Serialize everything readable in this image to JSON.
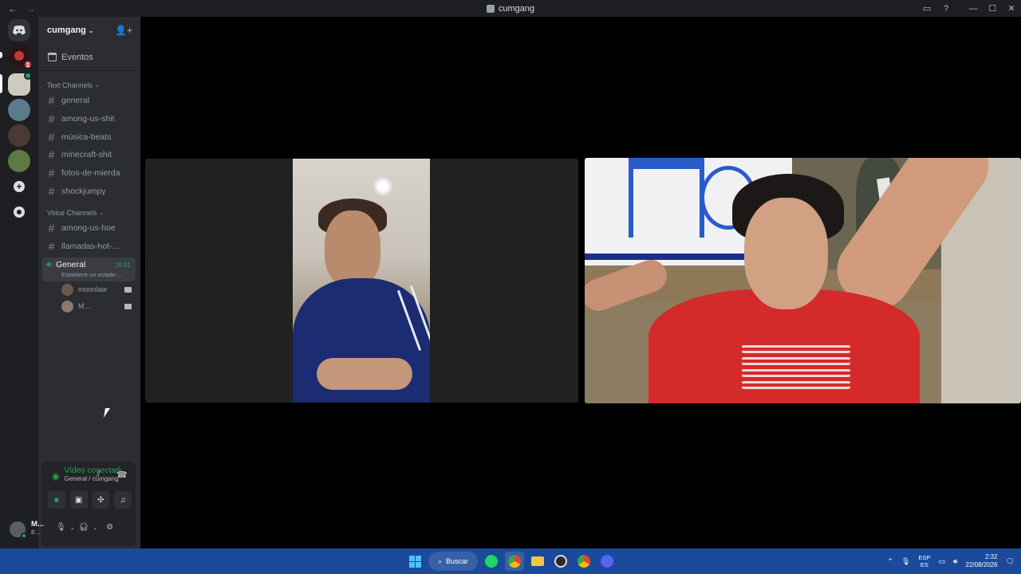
{
  "window": {
    "title": "cumgang",
    "back": "←",
    "forward": "→",
    "inbox_icon": "inbox-icon",
    "help": "?",
    "minimize": "—",
    "maximize": "☐",
    "close": "✕"
  },
  "rail": {
    "home_icon": "discord-logo-icon",
    "mention_badge": "1",
    "add_server": "+",
    "discover": "⌕"
  },
  "guild": {
    "name": "cumgang",
    "events": "Eventos",
    "text_category": "Text Channels",
    "text_channels": [
      "general",
      "among-us-shit",
      "música-beats",
      "minecraft-shit",
      "fotos-de-mierda",
      "shockjumpy"
    ],
    "voice_category": "Voice Channels",
    "voice_channels": [
      "among-us-hoe",
      "llamadas-hot-..."
    ],
    "active_voice": {
      "name": "General",
      "time": "16:41",
      "status": "Establece un estado ...",
      "users": [
        "moonlaw",
        "M..."
      ]
    }
  },
  "voice_panel": {
    "status": "Vídeo conectado",
    "location": "General / cumgang"
  },
  "user": {
    "name": "M...",
    "status": "E..."
  },
  "taskbar": {
    "search": "Buscar",
    "lang_top": "ESP",
    "lang_bottom": "ES",
    "time": "2:32",
    "date": "22/08/2026"
  }
}
